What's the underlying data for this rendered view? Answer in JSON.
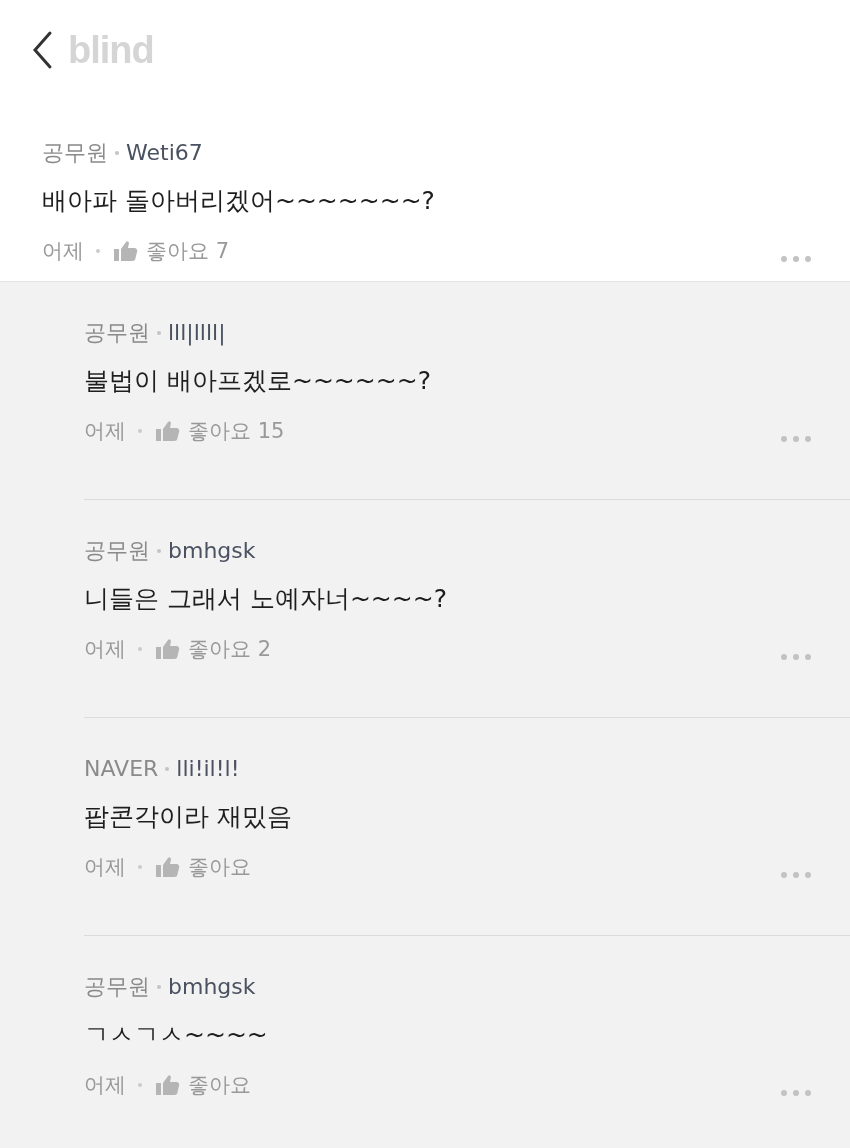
{
  "header": {
    "logo": "blind"
  },
  "post": {
    "company": "공무원",
    "author": "Weti67",
    "body": "배아파 돌아버리겠어~~~~~~~?",
    "time": "어제",
    "likes": "좋아요 7"
  },
  "replies": [
    {
      "company": "공무원",
      "author": "lll|llll|",
      "body": "불법이 배아프겠로~~~~~~?",
      "time": "어제",
      "likes": "좋아요 15"
    },
    {
      "company": "공무원",
      "author": "bmhgsk",
      "body": "니들은 그래서 노예자너~~~~?",
      "time": "어제",
      "likes": "좋아요 2"
    },
    {
      "company": "NAVER",
      "author": "lli!il!l!",
      "body": "팝콘각이라 재밌음",
      "time": "어제",
      "likes": "좋아요"
    },
    {
      "company": "공무원",
      "author": "bmhgsk",
      "body": "ㄱㅅㄱㅅ~~~~",
      "time": "어제",
      "likes": "좋아요"
    }
  ]
}
